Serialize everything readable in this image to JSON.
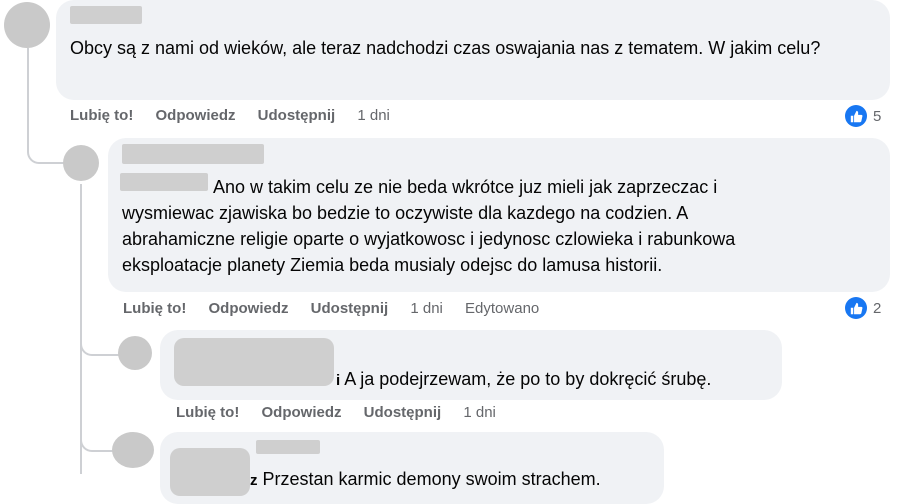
{
  "comments": [
    {
      "text": "Obcy są z nami od wieków, ale teraz nadchodzi czas oswajania nas z tematem. W jakim celu?",
      "actions": {
        "like": "Lubię to!",
        "reply": "Odpowiedz",
        "share": "Udostępnij",
        "time": "1 dni"
      },
      "likes": "5"
    },
    {
      "author_suffix": ":",
      "text_lines": [
        "Ano w takim celu ze nie beda wkrótce juz mieli jak zaprzeczac i",
        "wysmiewac zjawiska bo bedzie to oczywiste dla kazdego na codzien. A",
        "abrahamiczne religie oparte o wyjatkowosc i jedynosc czlowieka i rabunkowa",
        "eksploatacje planety Ziemia beda musialy odejsc do lamusa historii."
      ],
      "actions": {
        "like": "Lubię to!",
        "reply": "Odpowiedz",
        "share": "Udostępnij",
        "time": "1 dni",
        "edited": "Edytowano"
      },
      "likes": "2"
    },
    {
      "author_tail": "i",
      "text": "A ja podejrzewam, że po to by dokręcić śrubę.",
      "actions": {
        "like": "Lubię to!",
        "reply": "Odpowiedz",
        "share": "Udostępnij",
        "time": "1 dni"
      }
    },
    {
      "author_tail": "z",
      "text": "Przestan karmic demony swoim strachem."
    }
  ],
  "colors": {
    "accent": "#1877f2",
    "bubble": "#f0f2f5",
    "muted": "#65676b"
  },
  "icons": {
    "like": "thumbs-up-icon"
  }
}
